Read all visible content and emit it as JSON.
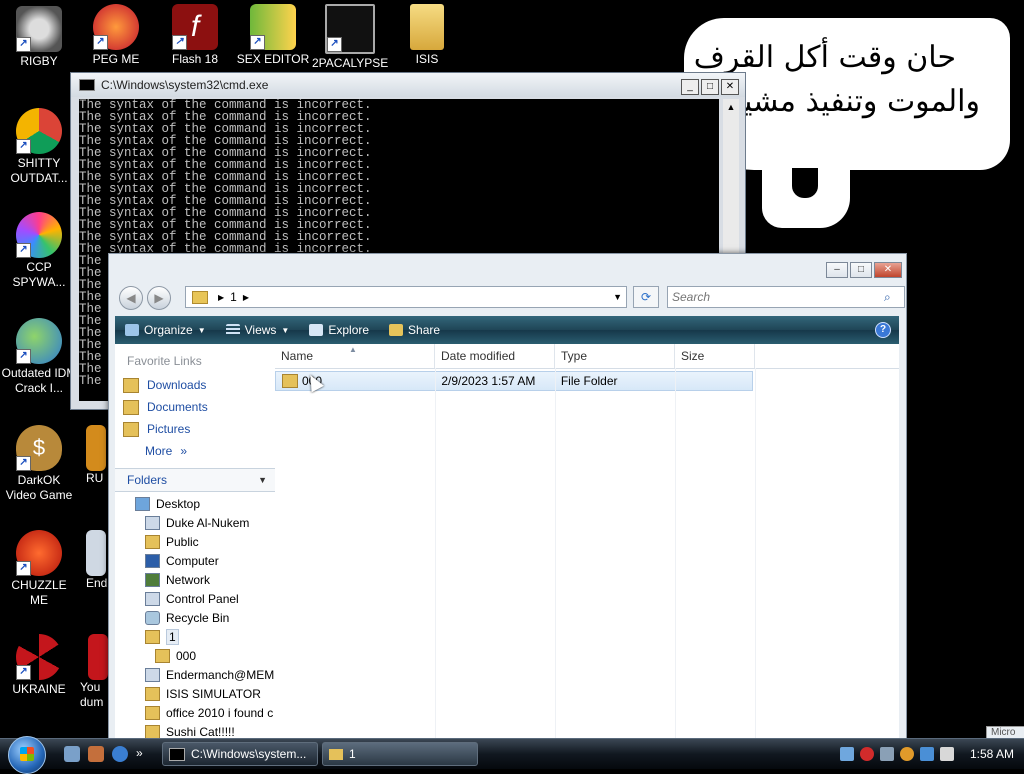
{
  "desktop": {
    "icons": [
      {
        "label": "RIGBY"
      },
      {
        "label": "PEG ME"
      },
      {
        "label": "Flash 18"
      },
      {
        "label": "SEX EDITOR"
      },
      {
        "label": "2PACALYPSE"
      },
      {
        "label": "ISIS"
      },
      {
        "label": "SHITTY OUTDAT..."
      },
      {
        "label": "CCP SPYWA..."
      },
      {
        "label": "Outdated IDM Crack I..."
      },
      {
        "label": "DarkOK Video Game"
      },
      {
        "label": "CHUZZLE ME"
      },
      {
        "label": "UKRAINE"
      },
      {
        "label": "RU"
      },
      {
        "label": "End"
      },
      {
        "label": "You dum"
      }
    ],
    "meme_text": {
      "line1": "حان وقت أكل القرف",
      "line2": "والموت وتنفيذ مشيئة"
    }
  },
  "cmd_window": {
    "title": "C:\\Windows\\system32\\cmd.exe",
    "lines": [
      "The syntax of the command is incorrect.",
      "The syntax of the command is incorrect.",
      "The syntax of the command is incorrect.",
      "The syntax of the command is incorrect.",
      "The syntax of the command is incorrect.",
      "The syntax of the command is incorrect.",
      "The syntax of the command is incorrect.",
      "The syntax of the command is incorrect.",
      "The syntax of the command is incorrect.",
      "The syntax of the command is incorrect.",
      "The syntax of the command is incorrect.",
      "The syntax of the command is incorrect.",
      "The syntax of the command is incorrect.",
      "The",
      "The",
      "The",
      "The",
      "The",
      "The",
      "The",
      "The",
      "The",
      "The",
      "The"
    ]
  },
  "explorer": {
    "address": {
      "crumb": "1"
    },
    "search": {
      "placeholder": "Search"
    },
    "toolbar": {
      "organize": "Organize",
      "views": "Views",
      "explore": "Explore",
      "share": "Share",
      "help": "?"
    },
    "favorites": {
      "heading": "Favorite Links",
      "items": [
        {
          "label": "Downloads"
        },
        {
          "label": "Documents"
        },
        {
          "label": "Pictures"
        }
      ],
      "more": "More"
    },
    "folders": {
      "heading": "Folders",
      "tree": [
        {
          "label": "Desktop"
        },
        {
          "label": "Duke Al-Nukem"
        },
        {
          "label": "Public"
        },
        {
          "label": "Computer"
        },
        {
          "label": "Network"
        },
        {
          "label": "Control Panel"
        },
        {
          "label": "Recycle Bin"
        },
        {
          "label": "1"
        },
        {
          "label": "000"
        },
        {
          "label": "Endermanch@MEM"
        },
        {
          "label": "ISIS SIMULATOR"
        },
        {
          "label": "office 2010 i found c"
        },
        {
          "label": "Sushi Cat!!!!!"
        }
      ]
    },
    "columns": {
      "name": "Name",
      "date": "Date modified",
      "type": "Type",
      "size": "Size"
    },
    "rows": [
      {
        "name": "000",
        "date": "2/9/2023 1:57 AM",
        "type": "File Folder",
        "size": ""
      }
    ]
  },
  "taskbar": {
    "buttons": [
      {
        "label": "C:\\Windows\\system..."
      },
      {
        "label": "1"
      }
    ],
    "clock": "1:58 AM",
    "peek_label": "Micro"
  }
}
